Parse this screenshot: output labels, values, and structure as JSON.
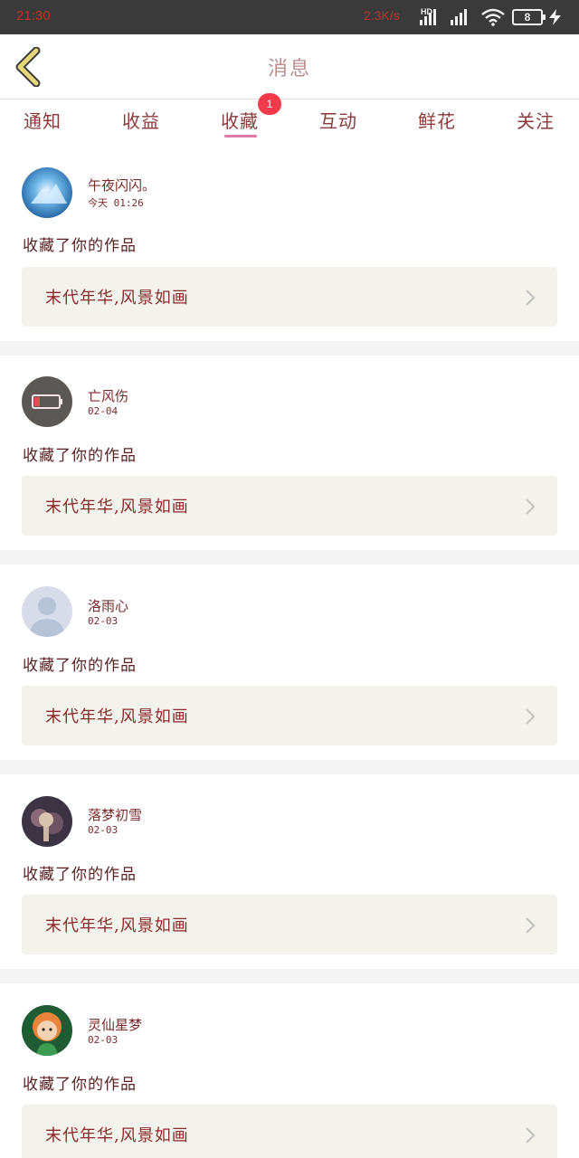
{
  "status_bar": {
    "time": "21:30",
    "network_speed": "2.3K/s",
    "hd_label": "HD",
    "battery_level": "8",
    "icons": [
      "signal-icon",
      "signal-icon",
      "wifi-icon",
      "battery-icon",
      "charging-icon"
    ]
  },
  "header": {
    "title": "消息",
    "back_icon": "chevron-left-icon"
  },
  "tabs": {
    "items": [
      "通知",
      "收益",
      "收藏",
      "互动",
      "鲜花",
      "关注"
    ],
    "active_index": 2,
    "badge": "1"
  },
  "colors": {
    "text": "#7a2a2a",
    "accent_underline": "#e07aa8",
    "badge": "#f23b4a",
    "work_card_bg": "#f3f3ec",
    "back_icon": "#c9b64a"
  },
  "messages": [
    {
      "username": "午夜闪闪。",
      "time": "今天 01:26",
      "action": "收藏了你的作品",
      "work_title": "末代年华,风景如画"
    },
    {
      "username": "亡风伤",
      "time": "02-04",
      "action": "收藏了你的作品",
      "work_title": "末代年华,风景如画"
    },
    {
      "username": "洛雨心",
      "time": "02-03",
      "action": "收藏了你的作品",
      "work_title": "末代年华,风景如画"
    },
    {
      "username": "落梦初雪",
      "time": "02-03",
      "action": "收藏了你的作品",
      "work_title": "末代年华,风景如画"
    },
    {
      "username": "灵仙星梦",
      "time": "02-03",
      "action": "收藏了你的作品",
      "work_title": "末代年华,风景如画"
    }
  ]
}
